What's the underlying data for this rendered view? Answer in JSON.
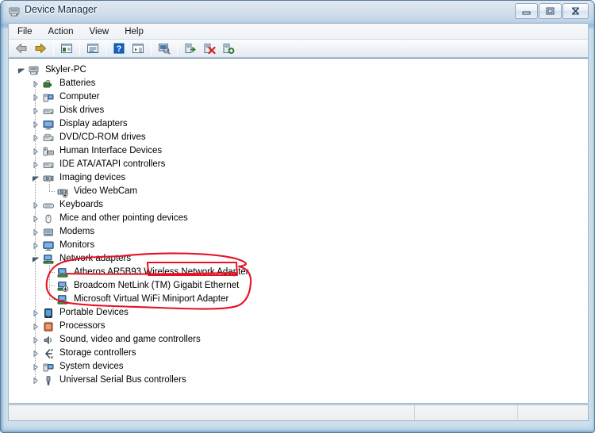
{
  "window": {
    "title": "Device Manager",
    "title_icon": "device-manager-icon",
    "caption": {
      "minimize": "minimize-icon",
      "maximize": "restore-icon",
      "close": "close-icon"
    }
  },
  "menubar": {
    "items": [
      {
        "label": "File",
        "name": "menu-file"
      },
      {
        "label": "Action",
        "name": "menu-action"
      },
      {
        "label": "View",
        "name": "menu-view"
      },
      {
        "label": "Help",
        "name": "menu-help"
      }
    ]
  },
  "toolbar": {
    "buttons": [
      {
        "name": "back-button",
        "icon": "back-arrow-icon",
        "tooltip": "Back"
      },
      {
        "name": "forward-button",
        "icon": "forward-arrow-icon",
        "tooltip": "Forward"
      },
      {
        "name": "separator-1",
        "icon": "separator",
        "tooltip": ""
      },
      {
        "name": "show-hide-console-tree-button",
        "icon": "console-tree-icon",
        "tooltip": "Show/Hide Console Tree"
      },
      {
        "name": "separator-2",
        "icon": "separator",
        "tooltip": ""
      },
      {
        "name": "properties-button",
        "icon": "properties-icon",
        "tooltip": "Properties"
      },
      {
        "name": "separator-3",
        "icon": "separator",
        "tooltip": ""
      },
      {
        "name": "help-button",
        "icon": "help-question-icon",
        "tooltip": "Help"
      },
      {
        "name": "show-hide-action-pane-button",
        "icon": "action-pane-icon",
        "tooltip": "Show/Hide Action Pane"
      },
      {
        "name": "separator-4",
        "icon": "separator",
        "tooltip": ""
      },
      {
        "name": "scan-for-hardware-changes-button",
        "icon": "scan-hardware-icon",
        "tooltip": "Scan for hardware changes"
      },
      {
        "name": "separator-5",
        "icon": "separator",
        "tooltip": ""
      },
      {
        "name": "update-driver-button",
        "icon": "update-driver-icon",
        "tooltip": "Update Driver Software"
      },
      {
        "name": "disable-device-button",
        "icon": "disable-device-icon",
        "tooltip": "Disable"
      },
      {
        "name": "enable-device-button",
        "icon": "enable-device-icon",
        "tooltip": "Enable"
      }
    ]
  },
  "tree": {
    "nodes": [
      {
        "label": "Skyler-PC",
        "depth": 0,
        "state": "expanded",
        "icon": "computer-root-icon",
        "name": "tree-node-skyler-pc"
      },
      {
        "label": "Batteries",
        "depth": 1,
        "state": "collapsed",
        "icon": "battery-icon",
        "name": "tree-node-batteries"
      },
      {
        "label": "Computer",
        "depth": 1,
        "state": "collapsed",
        "icon": "computer-icon",
        "name": "tree-node-computer"
      },
      {
        "label": "Disk drives",
        "depth": 1,
        "state": "collapsed",
        "icon": "disk-drive-icon",
        "name": "tree-node-disk-drives"
      },
      {
        "label": "Display adapters",
        "depth": 1,
        "state": "collapsed",
        "icon": "display-adapter-icon",
        "name": "tree-node-display-adapters"
      },
      {
        "label": "DVD/CD-ROM drives",
        "depth": 1,
        "state": "collapsed",
        "icon": "dvd-drive-icon",
        "name": "tree-node-dvd-cd-rom-drives"
      },
      {
        "label": "Human Interface Devices",
        "depth": 1,
        "state": "collapsed",
        "icon": "hid-icon",
        "name": "tree-node-human-interface-devices"
      },
      {
        "label": "IDE ATA/ATAPI controllers",
        "depth": 1,
        "state": "collapsed",
        "icon": "ide-controller-icon",
        "name": "tree-node-ide-ata-atapi-controllers"
      },
      {
        "label": "Imaging devices",
        "depth": 1,
        "state": "expanded",
        "icon": "imaging-device-icon",
        "name": "tree-node-imaging-devices"
      },
      {
        "label": "Video WebCam",
        "depth": 2,
        "state": "leaf",
        "icon": "webcam-icon",
        "name": "tree-node-video-webcam"
      },
      {
        "label": "Keyboards",
        "depth": 1,
        "state": "collapsed",
        "icon": "keyboard-icon",
        "name": "tree-node-keyboards"
      },
      {
        "label": "Mice and other pointing devices",
        "depth": 1,
        "state": "collapsed",
        "icon": "mouse-icon",
        "name": "tree-node-mice-and-other-pointing-devices"
      },
      {
        "label": "Modems",
        "depth": 1,
        "state": "collapsed",
        "icon": "modem-icon",
        "name": "tree-node-modems"
      },
      {
        "label": "Monitors",
        "depth": 1,
        "state": "collapsed",
        "icon": "monitor-icon",
        "name": "tree-node-monitors"
      },
      {
        "label": "Network adapters",
        "depth": 1,
        "state": "expanded",
        "icon": "network-adapter-icon",
        "name": "tree-node-network-adapters"
      },
      {
        "label": "Atheros AR5B93 Wireless Network Adapter",
        "depth": 2,
        "state": "leaf",
        "icon": "network-adapter-icon",
        "name": "tree-node-atheros-ar5b93-wireless-network-adapter"
      },
      {
        "label": "Broadcom NetLink (TM) Gigabit Ethernet",
        "depth": 2,
        "state": "leaf",
        "icon": "network-adapter-disabled-icon",
        "name": "tree-node-broadcom-netlink-gigabit-ethernet"
      },
      {
        "label": "Microsoft Virtual WiFi Miniport Adapter",
        "depth": 2,
        "state": "leaf",
        "icon": "network-adapter-icon",
        "name": "tree-node-microsoft-virtual-wifi-miniport-adapter"
      },
      {
        "label": "Portable Devices",
        "depth": 1,
        "state": "collapsed",
        "icon": "portable-device-icon",
        "name": "tree-node-portable-devices"
      },
      {
        "label": "Processors",
        "depth": 1,
        "state": "collapsed",
        "icon": "processor-icon",
        "name": "tree-node-processors"
      },
      {
        "label": "Sound, video and game controllers",
        "depth": 1,
        "state": "collapsed",
        "icon": "sound-controller-icon",
        "name": "tree-node-sound-video-and-game-controllers"
      },
      {
        "label": "Storage controllers",
        "depth": 1,
        "state": "collapsed",
        "icon": "storage-controller-icon",
        "name": "tree-node-storage-controllers"
      },
      {
        "label": "System devices",
        "depth": 1,
        "state": "collapsed",
        "icon": "system-device-icon",
        "name": "tree-node-system-devices"
      },
      {
        "label": "Universal Serial Bus controllers",
        "depth": 1,
        "state": "collapsed",
        "icon": "usb-controller-icon",
        "name": "tree-node-universal-serial-bus-controllers"
      }
    ]
  },
  "statusbar": {
    "main_text": "",
    "section_b": "",
    "section_c": ""
  },
  "annotation": {
    "color": "#e81123",
    "shapes": [
      {
        "type": "ellipse",
        "name": "red-circle-around-network-adapters"
      },
      {
        "type": "rectangle",
        "name": "red-box-around-wireless-network-adapter"
      }
    ]
  },
  "colors": {
    "accent": "#2a6099",
    "annotation_red": "#e81123",
    "content_bg": "#ffffff",
    "chrome": "#b9cfe3"
  }
}
